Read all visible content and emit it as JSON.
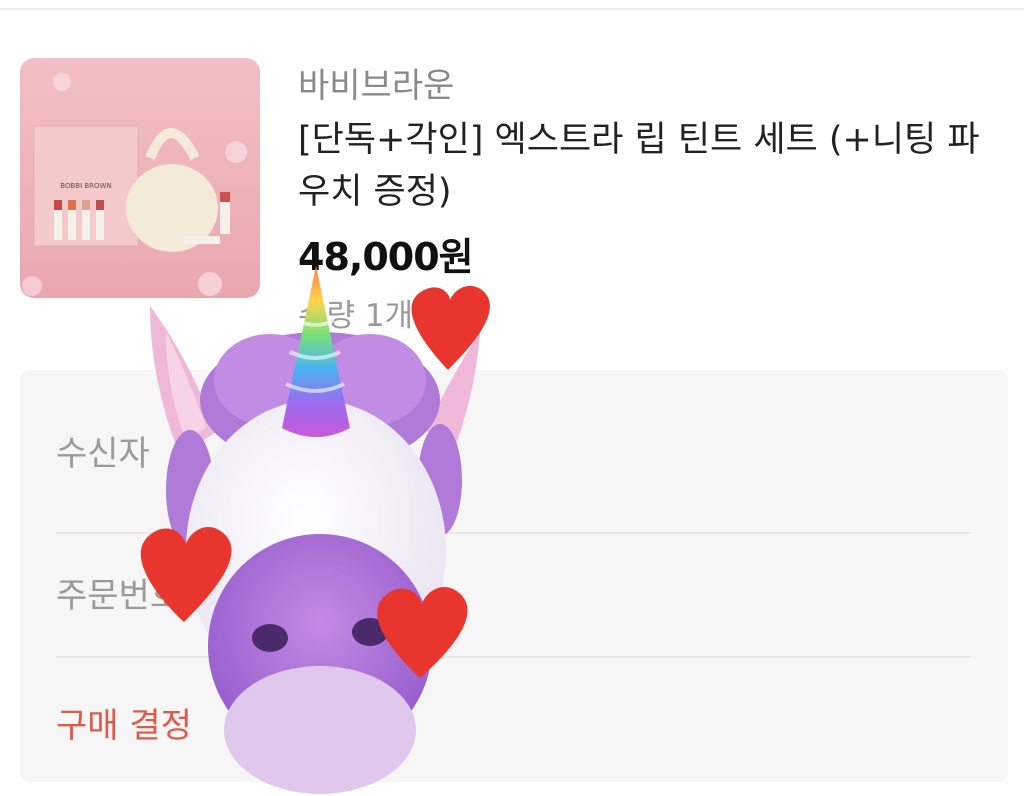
{
  "product": {
    "image_alt": "BOBBI BROWN",
    "brand": "바비브라운",
    "title": "[단독+각인] 엑스트라 립 틴트 세트 (+니팅 파우치 증정)",
    "price": "48,000원",
    "quantity": "수량 1개"
  },
  "details": {
    "recipient_label": "수신자",
    "order_number_label": "주문번호",
    "purchase_decision_label": "구매 결정"
  },
  "colors": {
    "accent_red": "#e05a4a",
    "panel_bg": "#f6f6f6",
    "muted_text": "#9a9a9a"
  },
  "overlay": {
    "icon": "unicorn-animoji-sticker"
  }
}
